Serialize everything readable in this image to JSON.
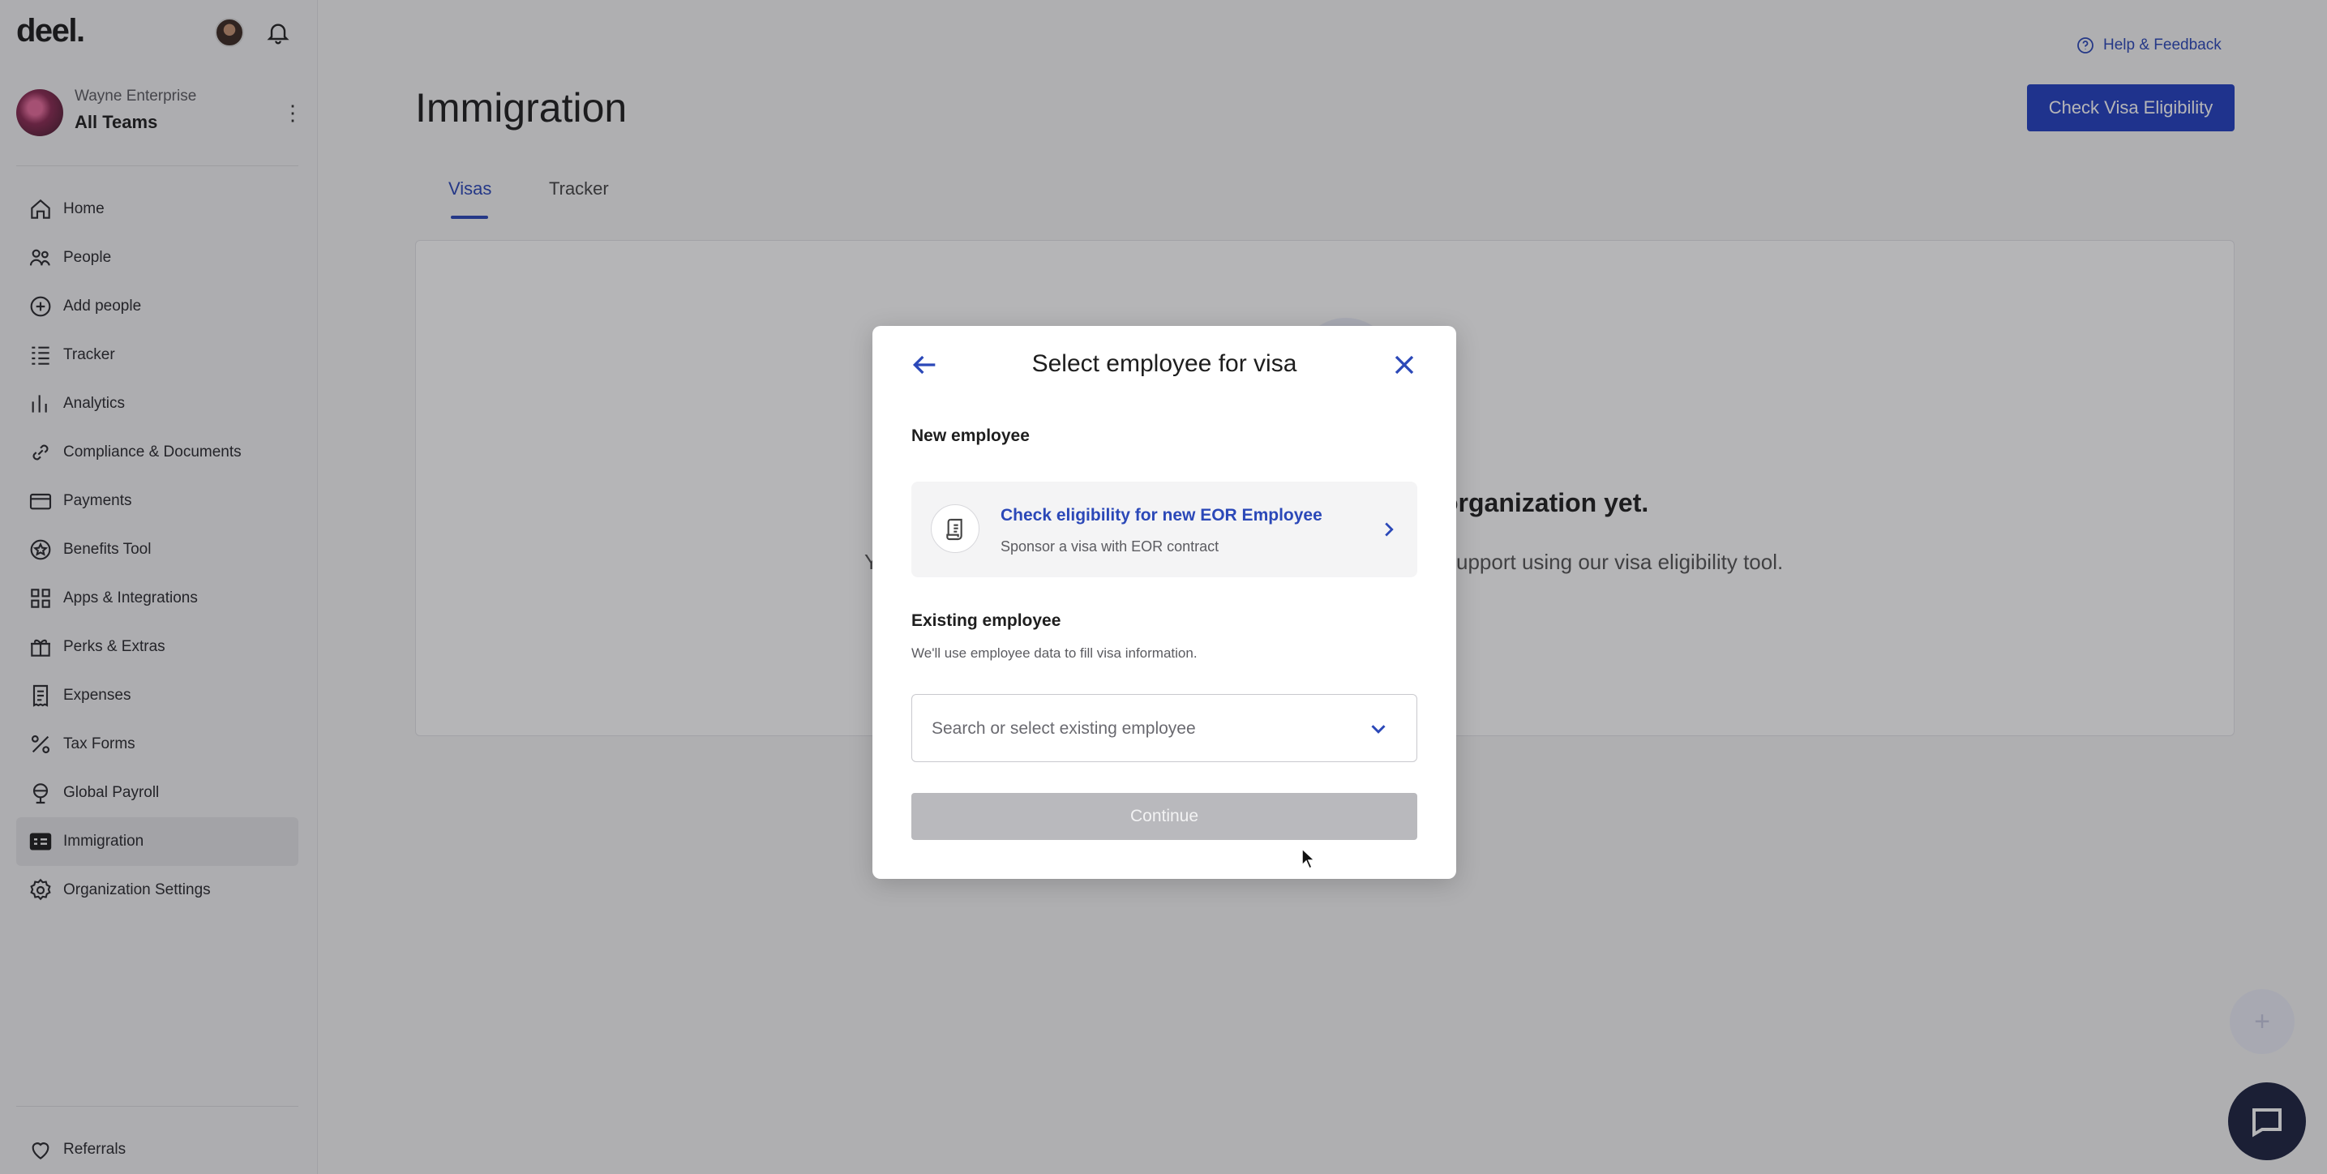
{
  "app": {
    "logo": "deel."
  },
  "sidebar": {
    "org_subtitle": "Wayne Enterprise",
    "org_name": "All Teams",
    "items": [
      {
        "label": "Home",
        "icon": "home-icon"
      },
      {
        "label": "People",
        "icon": "people-icon"
      },
      {
        "label": "Add people",
        "icon": "plus-circle-icon"
      },
      {
        "label": "Tracker",
        "icon": "list-icon"
      },
      {
        "label": "Analytics",
        "icon": "bar-chart-icon"
      },
      {
        "label": "Compliance & Documents",
        "icon": "link-icon"
      },
      {
        "label": "Payments",
        "icon": "credit-card-icon"
      },
      {
        "label": "Benefits Tool",
        "icon": "star-badge-icon"
      },
      {
        "label": "Apps & Integrations",
        "icon": "apps-grid-icon"
      },
      {
        "label": "Perks & Extras",
        "icon": "gift-icon"
      },
      {
        "label": "Expenses",
        "icon": "receipt-icon"
      },
      {
        "label": "Tax Forms",
        "icon": "percent-icon"
      },
      {
        "label": "Global Payroll",
        "icon": "globe-icon"
      },
      {
        "label": "Immigration",
        "icon": "id-card-icon",
        "active": true
      },
      {
        "label": "Organization Settings",
        "icon": "gear-icon"
      }
    ],
    "referrals": "Referrals"
  },
  "header": {
    "help": "Help & Feedback",
    "title": "Immigration",
    "primary_button": "Check Visa Eligibility",
    "tabs": [
      {
        "label": "Visas",
        "active": true
      },
      {
        "label": "Tracker"
      }
    ]
  },
  "empty_state": {
    "title_fragment": "organization yet.",
    "desc_fragment_left": "Y",
    "desc_fragment": "upport using our visa eligibility tool."
  },
  "modal": {
    "title": "Select employee for visa",
    "new_section": "New employee",
    "option_title": "Check eligibility for new EOR Employee",
    "option_subtitle": "Sponsor a visa with EOR contract",
    "existing_section": "Existing employee",
    "existing_desc": "We'll use employee data to fill visa information.",
    "select_placeholder": "Search or select existing employee",
    "continue": "Continue"
  },
  "colors": {
    "accent": "#2340C2",
    "link": "#2B48B8",
    "disabled": "#B9B9BD"
  }
}
